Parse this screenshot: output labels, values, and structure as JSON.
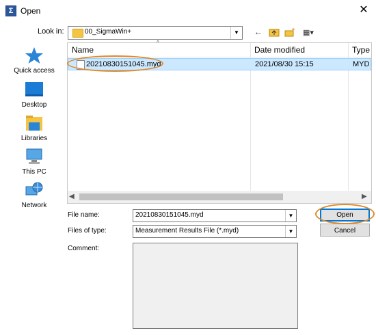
{
  "window": {
    "title": "Open",
    "app_icon_glyph": "Σ"
  },
  "toolbar": {
    "look_in_label": "Look in:",
    "look_in_value": "00_SigmaWin+",
    "back_icon": "←",
    "up_icon": "⮤",
    "new_folder_icon": "✱",
    "view_icon": "▦▾"
  },
  "places": [
    {
      "label": "Quick access",
      "icon": "star-icon"
    },
    {
      "label": "Desktop",
      "icon": "desktop-icon"
    },
    {
      "label": "Libraries",
      "icon": "libraries-icon"
    },
    {
      "label": "This PC",
      "icon": "computer-icon"
    },
    {
      "label": "Network",
      "icon": "network-icon"
    }
  ],
  "file_list": {
    "columns": [
      "Name",
      "Date modified",
      "Type"
    ],
    "rows": [
      {
        "name": "20210830151045.myd",
        "date": "2021/08/30 15:15",
        "type": "MYD"
      }
    ]
  },
  "fields": {
    "file_name_label": "File name:",
    "file_name_value": "20210830151045.myd",
    "file_type_label": "Files of type:",
    "file_type_value": "Measurement Results File (*.myd)",
    "comment_label": "Comment:"
  },
  "buttons": {
    "open": "Open",
    "cancel": "Cancel"
  },
  "colors": {
    "selection": "#cce8ff",
    "highlight_oval": "#e08a2b",
    "accent": "#0078d7"
  }
}
